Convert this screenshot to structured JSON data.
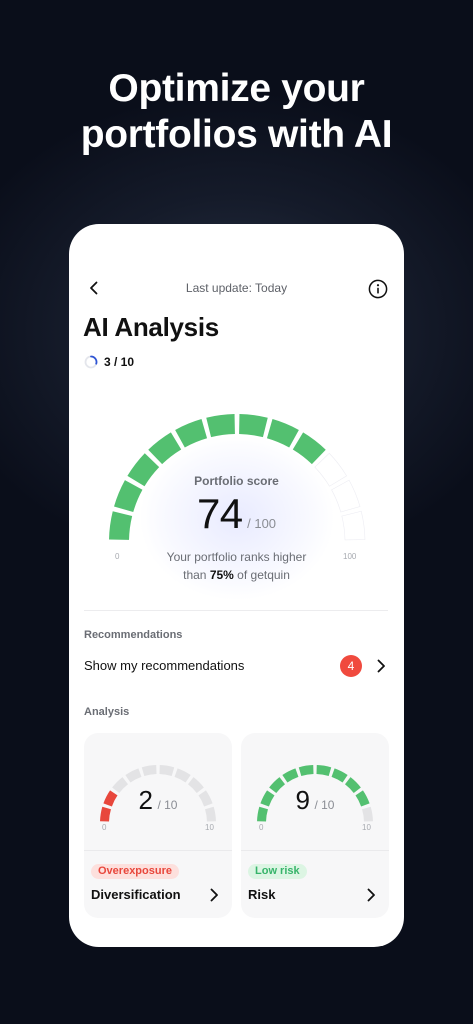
{
  "headline": {
    "line1": "Optimize your",
    "line2": "portfolios with AI"
  },
  "topbar": {
    "title": "Last update: Today",
    "back_icon": "chevron-left-icon",
    "info_icon": "info-icon"
  },
  "page": {
    "title": "AI Analysis",
    "progress_label": "3 / 10",
    "progress_fraction": 0.3
  },
  "portfolio_score": {
    "label": "Portfolio score",
    "value": "74",
    "max": "/ 100",
    "score": 74,
    "tick_min": "0",
    "tick_max": "100",
    "rank_before": "Your portfolio ranks higher",
    "rank_line2_start": "than ",
    "rank_percent": "75%",
    "rank_line2_end": " of getquin"
  },
  "recommendations": {
    "section_label": "Recommendations",
    "row_label": "Show my recommendations",
    "badge_count": "4"
  },
  "analysis": {
    "section_label": "Analysis",
    "tiles": [
      {
        "name": "Diversification",
        "value": "2",
        "max": "/ 10",
        "score": 2,
        "tick_min": "0",
        "tick_max": "10",
        "tag": "Overexposure",
        "tag_color": "#e8473c"
      },
      {
        "name": "Risk",
        "value": "9",
        "max": "/ 10",
        "score": 9,
        "tick_min": "0",
        "tick_max": "10",
        "tag": "Low risk",
        "tag_color": "#37b46a"
      }
    ]
  },
  "colors": {
    "gauge_green": "#53c070",
    "gauge_empty_main": "#ffffff",
    "gauge_empty_tile": "#e3e3e5",
    "gauge_red": "#e8473c",
    "accent_blue": "#2f55d4"
  }
}
